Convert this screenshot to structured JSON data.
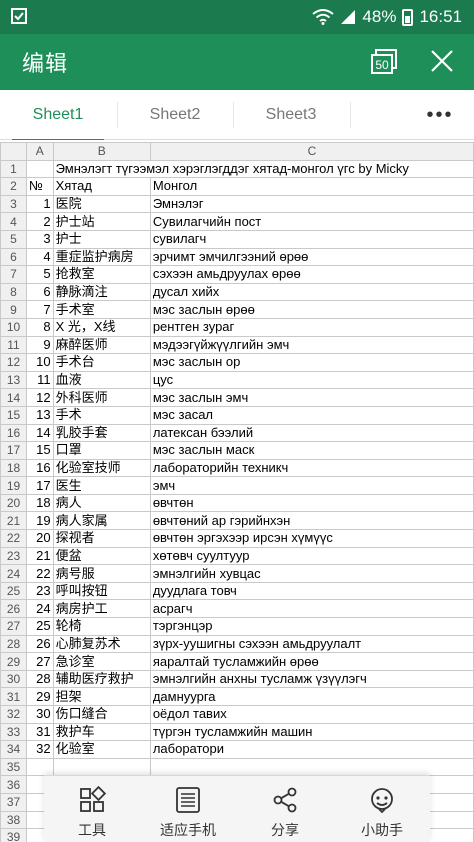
{
  "status_bar": {
    "battery": "48%",
    "time": "16:51",
    "icons": [
      "notification-icon",
      "wifi-icon",
      "signal-icon",
      "battery-icon"
    ]
  },
  "app_bar": {
    "title": "编辑",
    "zoom_label": "50"
  },
  "sheet_tabs": [
    {
      "label": "Sheet1",
      "active": true
    },
    {
      "label": "Sheet2",
      "active": false
    },
    {
      "label": "Sheet3",
      "active": false
    }
  ],
  "more_label": "•••",
  "grid": {
    "columns": [
      "A",
      "B",
      "C"
    ],
    "title": "Эмнэлэгт түгээмэл хэрэглэгддэг хятад-монгол үгс by Micky",
    "header": {
      "a": "№",
      "b": "Хятад",
      "c": "Монгол"
    },
    "rows": [
      {
        "n": "1",
        "zh": "医院",
        "mn": "Эмнэлэг"
      },
      {
        "n": "2",
        "zh": "护士站",
        "mn": "Сувилагчийн пост"
      },
      {
        "n": "3",
        "zh": "护士",
        "mn": "сувилагч"
      },
      {
        "n": "4",
        "zh": "重症监护病房",
        "mn": "эрчимт эмчилгээний өрөө"
      },
      {
        "n": "5",
        "zh": "抢救室",
        "mn": "сэхээн амьдруулах өрөө"
      },
      {
        "n": "6",
        "zh": "静脉滴注",
        "mn": "дусал хийх"
      },
      {
        "n": "7",
        "zh": "手术室",
        "mn": "мэс заслын өрөө"
      },
      {
        "n": "8",
        "zh": "X 光，X线",
        "mn": "рентген зураг"
      },
      {
        "n": "9",
        "zh": "麻醉医师",
        "mn": "мэдээгүйжүүлгийн эмч"
      },
      {
        "n": "10",
        "zh": "手术台",
        "mn": "мэс заслын ор"
      },
      {
        "n": "11",
        "zh": "血液",
        "mn": "цус"
      },
      {
        "n": "12",
        "zh": "外科医师",
        "mn": "мэс заслын эмч"
      },
      {
        "n": "13",
        "zh": "手术",
        "mn": "мэс засал"
      },
      {
        "n": "14",
        "zh": "乳胶手套",
        "mn": "латексан бээлий"
      },
      {
        "n": "15",
        "zh": "口罩",
        "mn": "мэс заслын маск"
      },
      {
        "n": "16",
        "zh": "化验室技师",
        "mn": "лабораторийн техникч"
      },
      {
        "n": "17",
        "zh": "医生",
        "mn": "эмч"
      },
      {
        "n": "18",
        "zh": "病人",
        "mn": "өвчтөн"
      },
      {
        "n": "19",
        "zh": "病人家属",
        "mn": "өвчтөний ар гэрийнхэн"
      },
      {
        "n": "20",
        "zh": "探视者",
        "mn": "өвчтөн эргэхээр ирсэн хүмүүс"
      },
      {
        "n": "21",
        "zh": "便盆",
        "mn": "хөтөвч суултуур"
      },
      {
        "n": "22",
        "zh": "病号服",
        "mn": "эмнэлгийн хувцас"
      },
      {
        "n": "23",
        "zh": "呼叫按钮",
        "mn": "дуудлага товч"
      },
      {
        "n": "24",
        "zh": "病房护工",
        "mn": "асрагч"
      },
      {
        "n": "25",
        "zh": "轮椅",
        "mn": "тэргэнцэр"
      },
      {
        "n": "26",
        "zh": "心肺复苏术",
        "mn": "зүрх-уушигны сэхээн амьдруулалт"
      },
      {
        "n": "27",
        "zh": "急诊室",
        "mn": "яаралтай тусламжийн өрөө"
      },
      {
        "n": "28",
        "zh": "辅助医疗救护",
        "mn": "эмнэлгийн анхны тусламж үзүүлэгч"
      },
      {
        "n": "29",
        "zh": "担架",
        "mn": "дамнуурга"
      },
      {
        "n": "30",
        "zh": "伤口缝合",
        "mn": "оёдол тавих"
      },
      {
        "n": "31",
        "zh": "救护车",
        "mn": "түргэн тусламжийн машин"
      },
      {
        "n": "32",
        "zh": "化验室",
        "mn": "лаборатори"
      }
    ],
    "row_numbers": [
      "1",
      "2",
      "3",
      "4",
      "5",
      "6",
      "7",
      "8",
      "9",
      "10",
      "11",
      "12",
      "13",
      "14",
      "15",
      "16",
      "17",
      "18",
      "19",
      "20",
      "21",
      "22",
      "23",
      "24",
      "25",
      "26",
      "27",
      "28",
      "29",
      "30",
      "31",
      "32",
      "33",
      "34",
      "35",
      "36",
      "37",
      "38",
      "39"
    ]
  },
  "toolbar": [
    {
      "label": "工具",
      "icon": "tools-grid-icon"
    },
    {
      "label": "适应手机",
      "icon": "fit-phone-icon"
    },
    {
      "label": "分享",
      "icon": "share-icon"
    },
    {
      "label": "小助手",
      "icon": "assistant-icon"
    }
  ],
  "colors": {
    "accent": "#1f8f5a",
    "status_bar": "#1b7a4e"
  }
}
